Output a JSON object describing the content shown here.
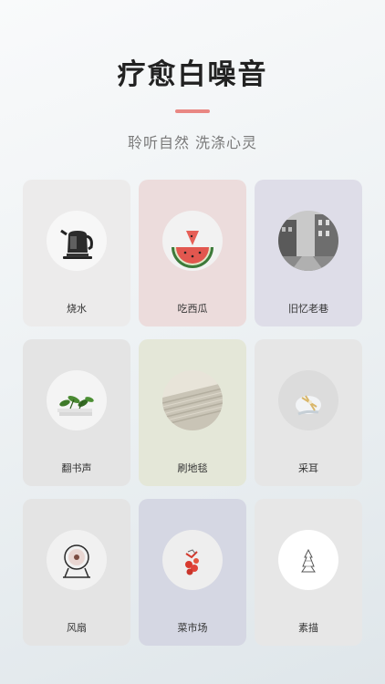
{
  "header": {
    "title": "疗愈白噪音",
    "subtitle": "聆听自然 洗涤心灵"
  },
  "sounds": [
    {
      "label": "烧水",
      "icon": "kettle-icon",
      "bg": "#ecebeb"
    },
    {
      "label": "吃西瓜",
      "icon": "watermelon-icon",
      "bg": "#ecdcdc"
    },
    {
      "label": "旧忆老巷",
      "icon": "old-street-icon",
      "bg": "#dedde8"
    },
    {
      "label": "翻书声",
      "icon": "book-plant-icon",
      "bg": "#e4e4e4"
    },
    {
      "label": "刷地毯",
      "icon": "carpet-icon",
      "bg": "#e4e7d8"
    },
    {
      "label": "采耳",
      "icon": "ear-cleaning-icon",
      "bg": "#e6e6e6"
    },
    {
      "label": "风扇",
      "icon": "fan-icon",
      "bg": "#e4e4e4"
    },
    {
      "label": "菜市场",
      "icon": "market-icon",
      "bg": "#d5d7e3"
    },
    {
      "label": "素描",
      "icon": "sketch-icon",
      "bg": "#e7e7e7"
    }
  ],
  "colors": {
    "accent": "#e98783",
    "title": "#222222",
    "subtitle": "#7a7a7a"
  }
}
